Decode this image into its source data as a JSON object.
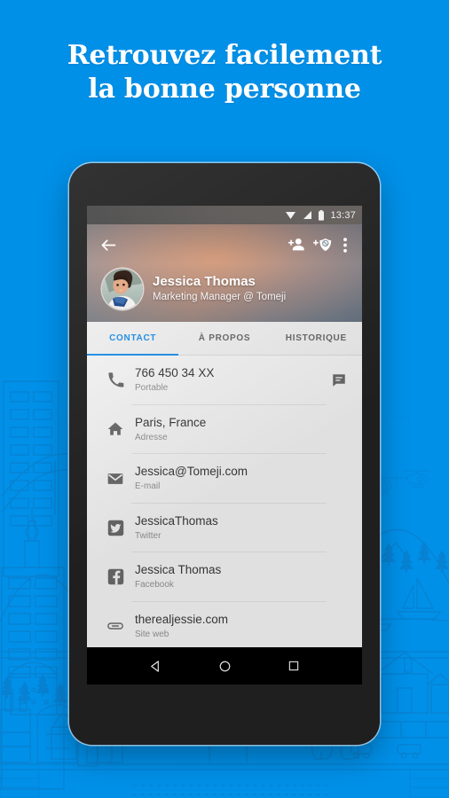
{
  "page": {
    "headline_line1": "Retrouvez facilement",
    "headline_line2": "la bonne personne",
    "background_color": "#0090e8",
    "accent_color": "#2196f3"
  },
  "phone": {
    "status_bar": {
      "time": "13:37",
      "icons": [
        "wifi-icon",
        "signal-icon",
        "battery-icon"
      ]
    },
    "toolbar": {
      "back": "back-arrow-icon",
      "add_contact": "add-person-icon",
      "block_contact": "add-block-shield-icon",
      "overflow": "more-vertical-icon"
    },
    "profile": {
      "name": "Jessica Thomas",
      "role": "Marketing Manager @ Tomeji",
      "avatar": "contact-photo"
    },
    "tabs": [
      {
        "label": "CONTACT",
        "active": true
      },
      {
        "label": "À PROPOS",
        "active": false
      },
      {
        "label": "HISTORIQUE",
        "active": false
      }
    ],
    "contact_rows": [
      {
        "icon": "phone-icon",
        "value": "766 450 34 XX",
        "label": "Portable",
        "action": "message-icon"
      },
      {
        "icon": "home-icon",
        "value": "Paris, France",
        "label": "Adresse",
        "action": ""
      },
      {
        "icon": "email-icon",
        "value": "Jessica@Tomeji.com",
        "label": "E-mail",
        "action": ""
      },
      {
        "icon": "twitter-icon",
        "value": "JessicaThomas",
        "label": "Twitter",
        "action": ""
      },
      {
        "icon": "facebook-icon",
        "value": "Jessica Thomas",
        "label": "Facebook",
        "action": ""
      },
      {
        "icon": "link-icon",
        "value": "therealjessie.com",
        "label": "Site web",
        "action": ""
      }
    ],
    "nav_bar": {
      "back": "nav-back-triangle-icon",
      "home": "nav-home-circle-icon",
      "recents": "nav-recents-square-icon"
    }
  }
}
